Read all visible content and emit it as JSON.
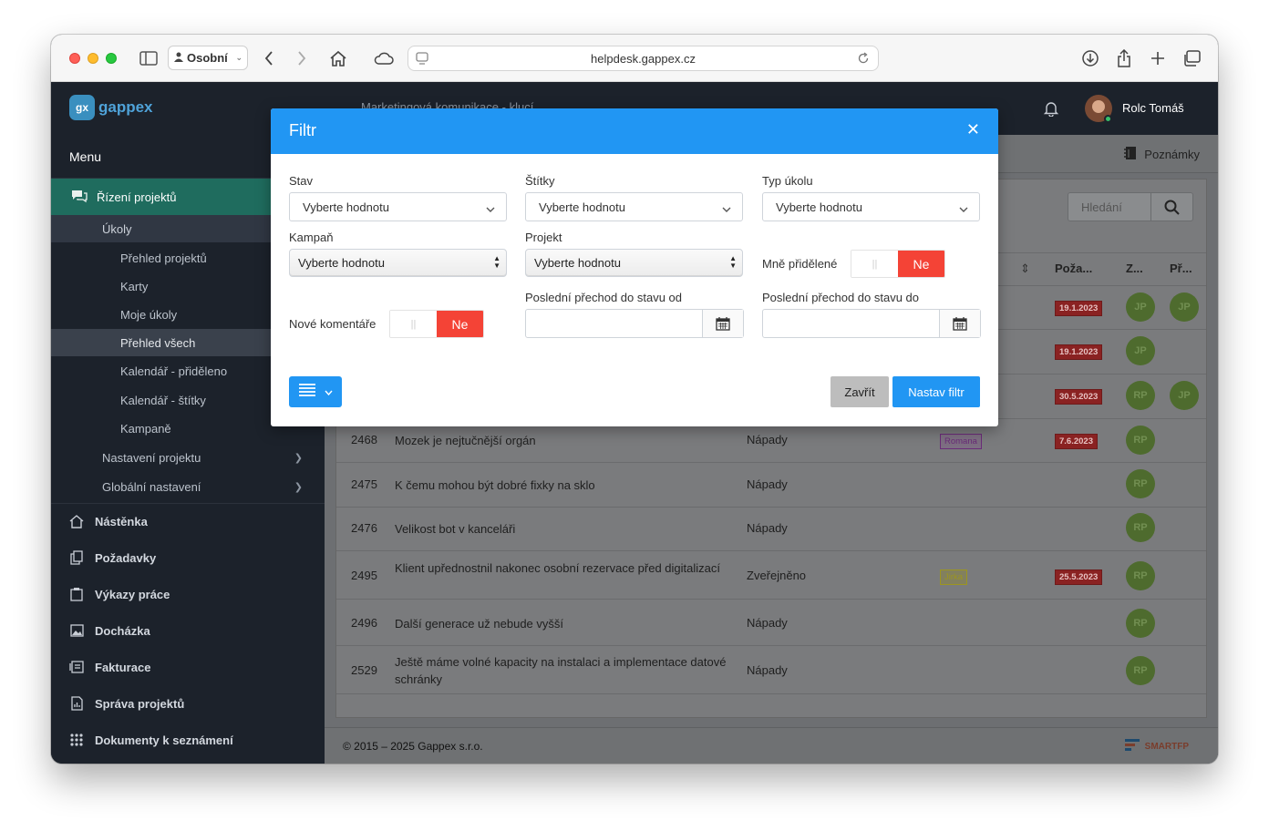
{
  "browser": {
    "profile": "Osobní",
    "url": "helpdesk.gappex.cz"
  },
  "app": {
    "logo_mark": "gx",
    "logo_text": "gappex",
    "breadcrumb": "Marketingová komunikace - klucí",
    "user_name": "Rolc Tomáš",
    "notes": "Poznámky",
    "search_placeholder": "Hledání",
    "footer": "© 2015 – 2025 Gappex s.r.o.",
    "footer_brand": "SMARTFP"
  },
  "sidebar": {
    "menu_title": "Menu",
    "active_section": "Řízení projektů",
    "ukoly": "Úkoly",
    "sub_items": [
      "Přehled projektů",
      "Karty",
      "Moje úkoly",
      "Přehled všech",
      "Kalendář - přiděleno",
      "Kalendář - štítky",
      "Kampaně"
    ],
    "settings": [
      "Nastavení projektu",
      "Globální nastavení"
    ],
    "main_items": [
      "Nástěnka",
      "Požadavky",
      "Výkazy práce",
      "Docházka",
      "Fakturace",
      "Správa projektů",
      "Dokumenty k seznámení"
    ]
  },
  "table": {
    "headers": [
      "Poža...",
      "Z...",
      "Př..."
    ],
    "top_rows": [
      {
        "date": "19.1.2023",
        "assignees": [
          "JP",
          "JP"
        ]
      },
      {
        "date": "19.1.2023",
        "assignees": [
          "JP"
        ]
      },
      {
        "date": "30.5.2023",
        "assignees": [
          "RP",
          "JP"
        ]
      }
    ],
    "rows": [
      {
        "id": "2468",
        "title": "Mozek je nejtučnější orgán",
        "category": "Nápady",
        "tag": "Romana",
        "date": "7.6.2023",
        "assignee": "RP"
      },
      {
        "id": "2475",
        "title": "K čemu mohou být dobré fixky na sklo",
        "category": "Nápady",
        "tag": "",
        "date": "",
        "assignee": "RP"
      },
      {
        "id": "2476",
        "title": "Velikost bot v kanceláři",
        "category": "Nápady",
        "tag": "",
        "date": "",
        "assignee": "RP"
      },
      {
        "id": "2495",
        "title": "Klient upřednostnil nakonec osobní rezervace před digitalizací",
        "category": "Zveřejněno",
        "tag": "Jirka",
        "date": "25.5.2023",
        "assignee": "RP"
      },
      {
        "id": "2496",
        "title": "Další generace už nebude vyšší",
        "category": "Nápady",
        "tag": "",
        "date": "",
        "assignee": "RP"
      },
      {
        "id": "2529",
        "title": "Ještě máme volné kapacity na instalaci a implementace datové schránky",
        "category": "Nápady",
        "tag": "",
        "date": "",
        "assignee": "RP"
      }
    ]
  },
  "modal": {
    "title": "Filtr",
    "stav_label": "Stav",
    "stav_value": "Vyberte hodnotu",
    "stitky_label": "Štítky",
    "stitky_value": "Vyberte hodnotu",
    "typ_label": "Typ úkolu",
    "typ_value": "Vyberte hodnotu",
    "kampan_label": "Kampaň",
    "kampan_value": "Vyberte hodnotu",
    "projekt_label": "Projekt",
    "projekt_value": "Vyberte hodnotu",
    "mne_label": "Mně přidělené",
    "mne_value": "Ne",
    "nove_label": "Nové komentáře",
    "nove_value": "Ne",
    "od_label": "Poslední přechod do stavu od",
    "do_label": "Poslední přechod do stavu do",
    "close_label": "Zavřít",
    "apply_label": "Nastav filtr"
  },
  "colors": {
    "accent": "#2196f3",
    "danger": "#f44336",
    "sidebar_active": "#1f6c5e",
    "sidebar_bg": "#1c222b"
  }
}
